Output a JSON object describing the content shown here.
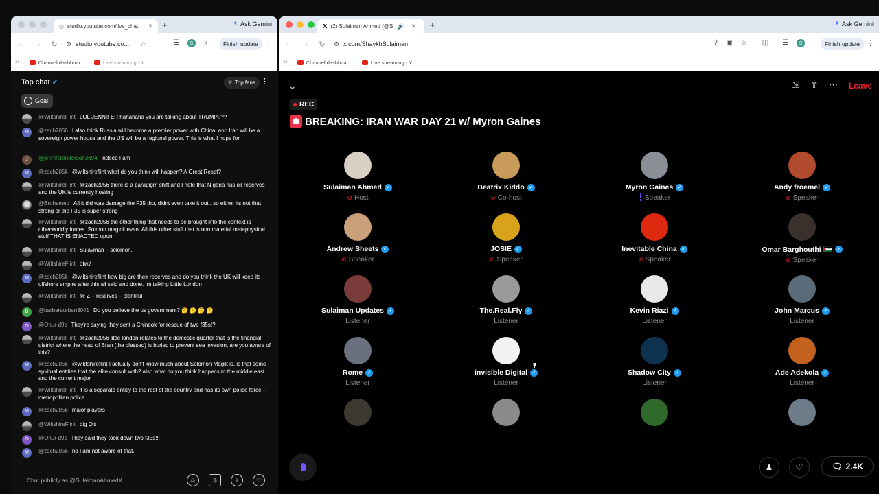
{
  "left_window": {
    "tab_title": "studio.youtube.com/live_chat",
    "new_tab": "+",
    "gemini": "Ask Gemini",
    "url": "studio.youtube.co...",
    "finish_update": "Finish update",
    "bookmarks": [
      "Channel dashboar...",
      "Live streaming - Y..."
    ],
    "chat": {
      "title": "Top chat",
      "goal": "Goal",
      "top_fans": "Top fans",
      "input_placeholder": "Chat publicly as @SulaimanAhmedX...",
      "messages": [
        {
          "author": "@WiltshireFlint",
          "text": "LOL JENNIFER hahahaha you are talking about TRUMP???",
          "avatar": "img",
          "initial": ""
        },
        {
          "author": "@zach2056",
          "text": "I also think Russia will become a premier power with China. and Iran will be a sovereign power house and the US will be a regional power. This is what I hope for",
          "avatar": "m",
          "initial": "M"
        },
        {
          "author": "@jenniferanderson3694",
          "text": "indeed I am",
          "avatar": "j",
          "initial": "J",
          "green": true
        },
        {
          "author": "@zach2056",
          "text": "@wiltshireflint what do you think will happen? A Great Reset?",
          "avatar": "m",
          "initial": "M"
        },
        {
          "author": "@WiltshireFlint",
          "text": "@zach2056 there is a paradigm shift and I note that Nigeria has oil reserves and the UK is currently hosting",
          "avatar": "img",
          "initial": ""
        },
        {
          "author": "@Brohamed",
          "text": "All it did was damage the F35 tho, didnt even take it out.. so either its not that strong or the F35 is super strong",
          "avatar": "img2",
          "initial": ""
        },
        {
          "author": "@WiltshireFlint",
          "text": "@zach2056 the other thing that needs to be brought into the context is otherworldly forces. Solmon magick even. All this other stuff that is non material metaphysical stuff THAT IS ENACTED upon.",
          "avatar": "img",
          "initial": ""
        },
        {
          "author": "@WiltshireFlint",
          "text": "Sulayman – solomon.",
          "avatar": "img",
          "initial": ""
        },
        {
          "author": "@WiltshireFlint",
          "text": "btw./",
          "avatar": "img",
          "initial": ""
        },
        {
          "author": "@zach2056",
          "text": "@wiltshireflint how big are their reserves and do you think the UK will keep its offshore empire after this all said and done. Im talking Little London",
          "avatar": "m",
          "initial": "M"
        },
        {
          "author": "@WiltshireFlint",
          "text": "@ Z – reserves – plentiful",
          "avatar": "img",
          "initial": ""
        },
        {
          "author": "@barbaraurban3041",
          "text": "Do you believe the us government? 🤔 🤔 🤔 🤔",
          "avatar": "b",
          "initial": "B"
        },
        {
          "author": "@Onur-d9c",
          "text": "They're saying they sent a Chinook for rescue of two f35s!?",
          "avatar": "o",
          "initial": "O"
        },
        {
          "author": "@WiltshireFlint",
          "text": "@zach2056 little london relates to the domestic quarter that is the financial district where the head of Bran (the blessed) is buried to prevent sea invasion, are you aware of this?",
          "avatar": "img",
          "initial": ""
        },
        {
          "author": "@zach2056",
          "text": "@wiktshireflint I actually don't know much about Solomon Magik is. is that some spiritual entities that the elite consult with? also what do you think happens to the middle east and the current major",
          "avatar": "m",
          "initial": "M"
        },
        {
          "author": "@WiltshireFlint",
          "text": "it is a separate entitiy to the rest of the country and has its own police force – metropolitan police.",
          "avatar": "img",
          "initial": ""
        },
        {
          "author": "@zach2056",
          "text": "major players",
          "avatar": "m",
          "initial": "M"
        },
        {
          "author": "@WiltshireFlint",
          "text": "big Q's",
          "avatar": "img",
          "initial": ""
        },
        {
          "author": "@Onur-d9c",
          "text": "They said they took down two f35s!!!",
          "avatar": "o",
          "initial": "O"
        },
        {
          "author": "@zach2056",
          "text": "no I am not aware of that.",
          "avatar": "m",
          "initial": "M"
        }
      ]
    }
  },
  "right_window": {
    "tab_title": "(2) Sulaiman Ahmed (@Sl",
    "new_tab": "+",
    "gemini": "Ask Gemini",
    "url": "x.com/ShaykhSulaiman",
    "finish_update": "Finish update",
    "bookmarks": [
      "Channel dashboar...",
      "Live streaming - Y..."
    ],
    "space": {
      "rec": "REC",
      "title": "BREAKING: IRAN WAR DAY 21 w/ Myron Gaines",
      "leave": "Leave",
      "listener_count": "2.4K",
      "participants": [
        {
          "name": "Sulaiman Ahmed",
          "role": "Host",
          "icon": "muted",
          "color": "#d9d0c4"
        },
        {
          "name": "Beatrix Kiddo",
          "role": "Co-host",
          "icon": "muted",
          "color": "#c99b5a"
        },
        {
          "name": "Myron Gaines",
          "role": "Speaker",
          "icon": "talking",
          "color": "#8a8f96"
        },
        {
          "name": "Andy froemel",
          "role": "Speaker",
          "icon": "muted",
          "color": "#b24a2e"
        },
        {
          "name": "Andrew Sheets",
          "role": "Speaker",
          "icon": "muted",
          "color": "#c9a07a"
        },
        {
          "name": "JOSIE",
          "role": "Speaker",
          "icon": "muted",
          "color": "#d9a21b"
        },
        {
          "name": "Inevitable China",
          "role": "Speaker",
          "icon": "muted",
          "color": "#de2910"
        },
        {
          "name": "Omar Barghouthi 🇵🇸",
          "role": "Speaker",
          "icon": "muted",
          "color": "#3a302c"
        },
        {
          "name": "Sulaiman Updates",
          "role": "Listener",
          "icon": "none",
          "color": "#7a3b3b"
        },
        {
          "name": "The.Real.Fly",
          "role": "Listener",
          "icon": "none",
          "color": "#9a9a9a"
        },
        {
          "name": "Kevin Riazi",
          "role": "Listener",
          "icon": "none",
          "color": "#e8e8e8"
        },
        {
          "name": "John Marcus",
          "role": "Listener",
          "icon": "none",
          "color": "#5a6b7a"
        },
        {
          "name": "Rome",
          "role": "Listener",
          "icon": "none",
          "color": "#6a7080"
        },
        {
          "name": "invisible Digital",
          "role": "Listener",
          "icon": "none",
          "color": "#f2f2f2"
        },
        {
          "name": "Shadow City",
          "role": "Listener",
          "icon": "none",
          "color": "#0e3350"
        },
        {
          "name": "Ade Adekola",
          "role": "Listener",
          "icon": "none",
          "color": "#c3621f"
        },
        {
          "name": "",
          "role": "",
          "icon": "none",
          "color": "#3c3a30"
        },
        {
          "name": "",
          "role": "",
          "icon": "none",
          "color": "#8a8a8a"
        },
        {
          "name": "",
          "role": "",
          "icon": "none",
          "color": "#2f6a2a"
        },
        {
          "name": "",
          "role": "",
          "icon": "none",
          "color": "#6d7c88"
        }
      ]
    }
  }
}
